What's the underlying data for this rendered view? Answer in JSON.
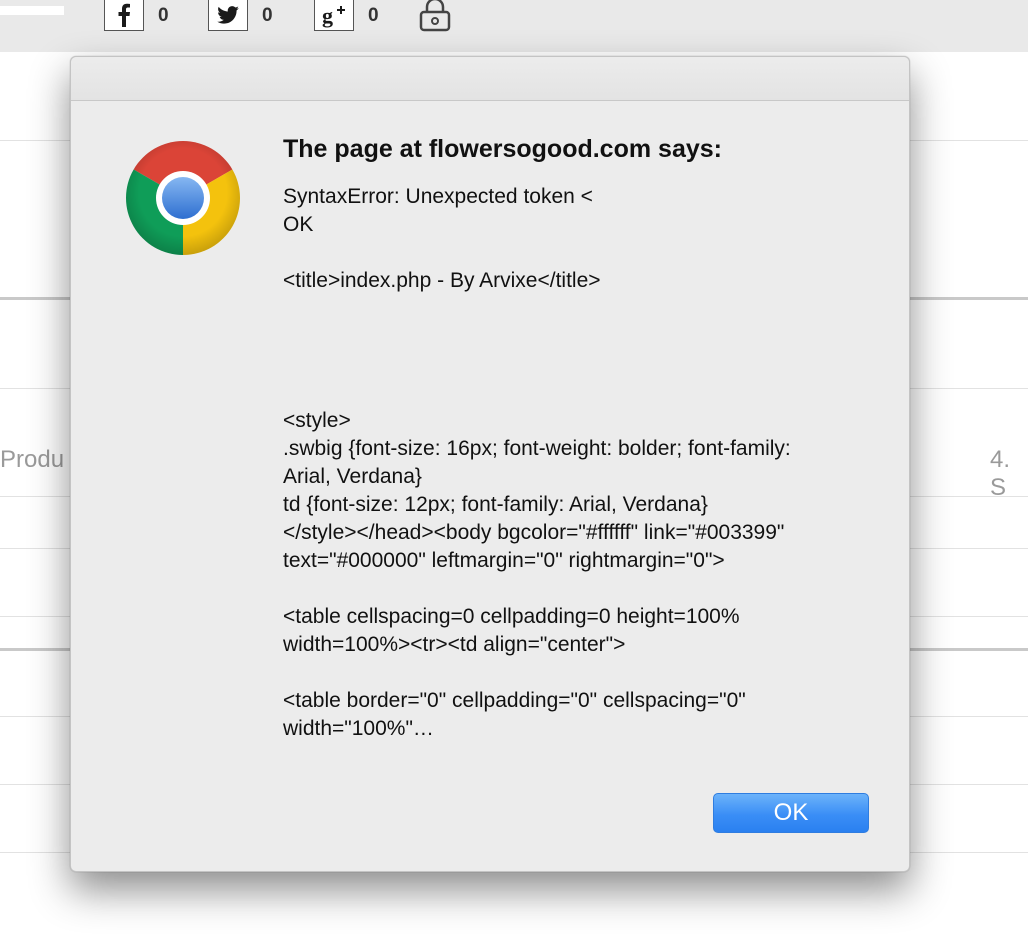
{
  "page": {
    "share": [
      {
        "network": "facebook",
        "icon": "facebook-icon",
        "glyph": "f",
        "count": "0"
      },
      {
        "network": "twitter",
        "icon": "twitter-icon",
        "glyph": "",
        "count": "0"
      },
      {
        "network": "google-plus",
        "icon": "google-plus-icon",
        "glyph": "g+",
        "count": "0"
      }
    ],
    "left_partial_text": "Produ",
    "right_partial_text": "4. S"
  },
  "dialog": {
    "title": "The page at flowersogood.com says:",
    "message": "SyntaxError: Unexpected token <\nOK\n\n<title>index.php - By Arvixe</title>\n\n\n\n\n<style>\n.swbig {font-size: 16px; font-weight: bolder; font-family: Arial, Verdana}\ntd {font-size: 12px; font-family: Arial, Verdana}\n</style></head><body bgcolor=\"#ffffff\" link=\"#003399\" text=\"#000000\" leftmargin=\"0\" rightmargin=\"0\">\n\n<table cellspacing=0 cellpadding=0 height=100% width=100%><tr><td align=\"center\">\n\n<table border=\"0\" cellpadding=\"0\" cellspacing=\"0\" width=\"100%\"…",
    "ok_label": "OK"
  },
  "colors": {
    "ok_button": "#3a8ef6",
    "dialog_bg": "#ececec"
  }
}
